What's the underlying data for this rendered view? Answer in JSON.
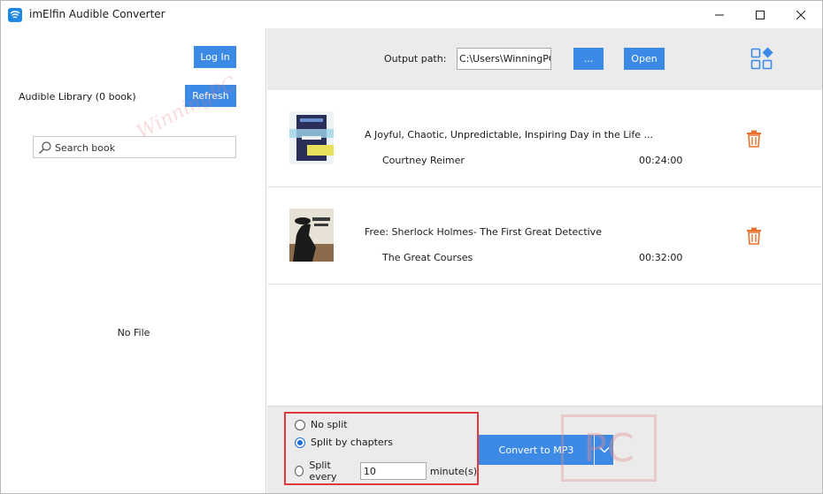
{
  "window": {
    "title": "imElfin Audible Converter"
  },
  "left_panel": {
    "login_label": "Log In",
    "library_label": "Audible Library (0 book)",
    "refresh_label": "Refresh",
    "search_placeholder": "Search book",
    "empty_text": "No File",
    "watermark_text": "WinningPC"
  },
  "toolbar": {
    "output_label": "Output path:",
    "output_value": "C:\\Users\\WinningPC\\Music\\imElfin",
    "browse_label": "...",
    "open_label": "Open"
  },
  "books": [
    {
      "title": "A Joyful, Chaotic, Unpredictable, Inspiring Day in the Life ...",
      "author": "Courtney Reimer",
      "duration": "00:24:00",
      "cover_colors": [
        "#2a2f5a",
        "#9fd4e8",
        "#e8e05a"
      ]
    },
    {
      "title": "Free: Sherlock Holmes- The First Great Detective",
      "author": "The Great Courses",
      "duration": "00:32:00",
      "cover_colors": [
        "#e8e2d6",
        "#1b1b1b",
        "#8b6b4a"
      ]
    }
  ],
  "split_options": {
    "no_split": "No split",
    "by_chapters": "Split by chapters",
    "split_every": "Split every",
    "minutes_value": "10",
    "minutes_unit": "minute(s)",
    "selected": "by_chapters"
  },
  "convert": {
    "label": "Convert to MP3",
    "watermark": "PC"
  },
  "colors": {
    "accent": "#3c8ae6",
    "trash": "#e8712f",
    "highlight": "#e0393e",
    "radio": "#1e6fd9"
  }
}
